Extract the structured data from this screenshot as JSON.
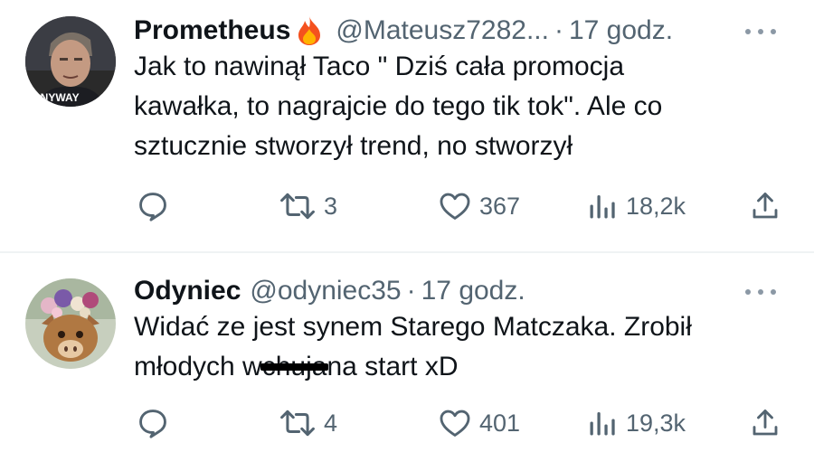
{
  "tweets": [
    {
      "display_name": "Prometheus",
      "badge_icon": "fire-emoji-icon",
      "handle": "@Mateusz7282...",
      "separator": "·",
      "time": "17 godz.",
      "avatar_caption": "ANYWAY",
      "lines": [
        "Jak to nawinął Taco \" Dziś cała promocja",
        "kawałka, to nagrajcie do tego tik tok\". Ale co",
        "sztucznie stworzył trend, no stworzył"
      ],
      "stats": {
        "replies": "",
        "retweets": "3",
        "likes": "367",
        "views": "18,2k"
      }
    },
    {
      "display_name": "Odyniec",
      "handle": "@odyniec35",
      "separator": "·",
      "time": "17 godz.",
      "lines": [
        "Widać ze jest synem Starego Matczaka. Zrobił"
      ],
      "line2_before": "młodych w",
      "line2_censored": "chuja",
      "line2_after": "na start xD",
      "stats": {
        "replies": "",
        "retweets": "4",
        "likes": "401",
        "views": "19,3k"
      }
    }
  ],
  "colors": {
    "text": "#0f1419",
    "secondary": "#536471",
    "divider": "#eff3f4"
  }
}
